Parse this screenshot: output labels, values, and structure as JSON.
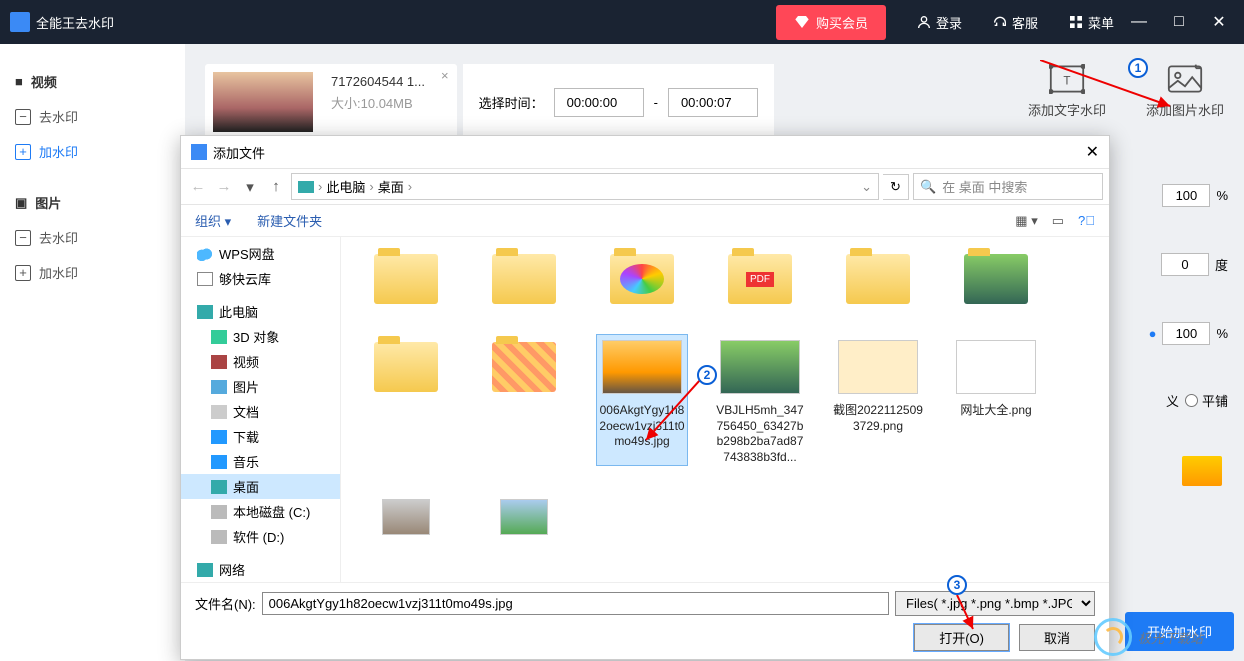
{
  "app": {
    "title": "全能王去水印"
  },
  "titlebar": {
    "buy": "购买会员",
    "login": "登录",
    "support": "客服",
    "menu": "菜单"
  },
  "nav": {
    "video_group": "视频",
    "video_remove": "去水印",
    "video_add": "加水印",
    "image_group": "图片",
    "image_remove": "去水印",
    "image_add": "加水印"
  },
  "video": {
    "filename": "7172604544 1...",
    "size_label": "大小:",
    "size_value": "10.04MB",
    "select_time": "选择时间：",
    "time_start": "00:00:00",
    "time_sep": "-",
    "time_end": "00:00:07"
  },
  "actions": {
    "text_wm": "添加文字水印",
    "image_wm": "添加图片水印",
    "start": "开始加水印"
  },
  "panel": {
    "v1": "100",
    "u1": "%",
    "v2": "0",
    "u2": "度",
    "v3": "100",
    "u3": "%",
    "radio_a": "义",
    "radio_b": "平铺"
  },
  "dialog": {
    "title": "添加文件",
    "crumb_pc_icon": "此电脑",
    "crumb_desktop": "桌面",
    "search_placeholder": "在 桌面 中搜索",
    "organize": "组织",
    "newfolder": "新建文件夹",
    "tree": {
      "wps": "WPS网盘",
      "quick": "够快云库",
      "thispc": "此电脑",
      "obj3d": "3D 对象",
      "videos": "视频",
      "images": "图片",
      "docs": "文档",
      "downloads": "下载",
      "music": "音乐",
      "desktop": "桌面",
      "cdrive": "本地磁盘 (C:)",
      "ddrive": "软件 (D:)",
      "network": "网络"
    },
    "files": {
      "f_sel": "006AkgtYgy1h82oecw1vzj311t0mo49s.jpg",
      "f2": "VBJLH5mh_347756450_63427bb298b2ba7ad87743838b3fd...",
      "f3": "截图20221125093729.png",
      "f4": "网址大全.png"
    },
    "filename_label": "文件名(N):",
    "filename_value": "006AkgtYgy1h82oecw1vzj311t0mo49s.jpg",
    "filetype": "Files( *.jpg *.png *.bmp *.JPG",
    "open": "打开(O)",
    "cancel": "取消"
  },
  "watermark_site": "极光下载站"
}
